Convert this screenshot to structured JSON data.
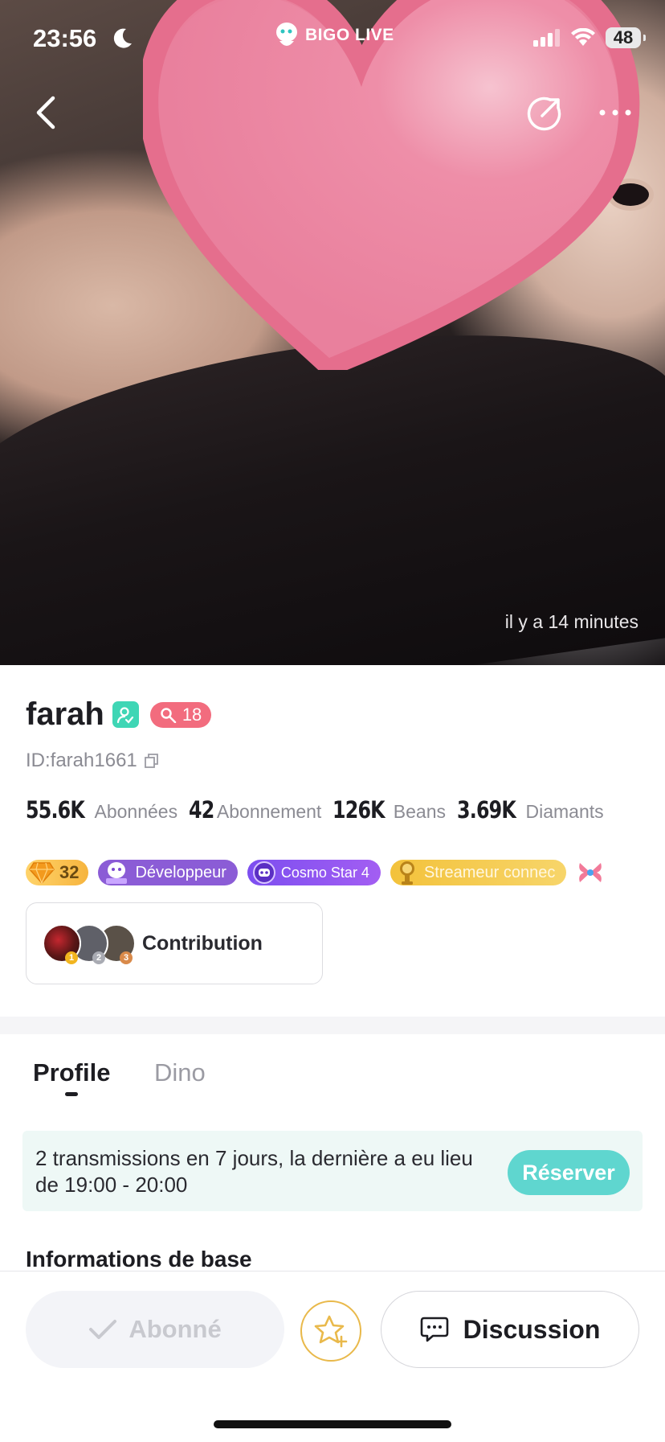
{
  "status_bar": {
    "time": "23:56",
    "app_brand": "BIGO LIVE",
    "battery_level": "48"
  },
  "hero": {
    "time_ago": "il y a 14 minutes"
  },
  "profile": {
    "name": "farah",
    "level": "18",
    "user_id": "ID:farah1661",
    "stats": [
      {
        "value": "55.6K",
        "label": "Abonnées"
      },
      {
        "value": "42",
        "label": "Abonnement"
      },
      {
        "value": "126K",
        "label": "Beans"
      },
      {
        "value": "3.69K",
        "label": "Diamants"
      }
    ],
    "badges": {
      "diamond_level": "32",
      "developer": "Développeur",
      "cosmo": "Cosmo Star 4",
      "streamer": "Streameur connec"
    },
    "contribution": {
      "label": "Contribution",
      "ranks": [
        "1",
        "2",
        "3"
      ]
    }
  },
  "tabs": [
    {
      "label": "Profile",
      "active": true
    },
    {
      "label": "Dino",
      "active": false
    }
  ],
  "schedule": {
    "text": "2 transmissions en 7 jours, la dernière a eu lieu de  19:00 - 20:00",
    "button": "Réserver"
  },
  "section_title": "Informations de base",
  "bottom_bar": {
    "followed_label": "Abonné",
    "chat_label": "Discussion"
  },
  "colors": {
    "accent_teal": "#5fd6cf",
    "level_pink": "#f26c7e",
    "developer_purple": "#8b5cd6",
    "star_gold": "#e9b94b"
  }
}
